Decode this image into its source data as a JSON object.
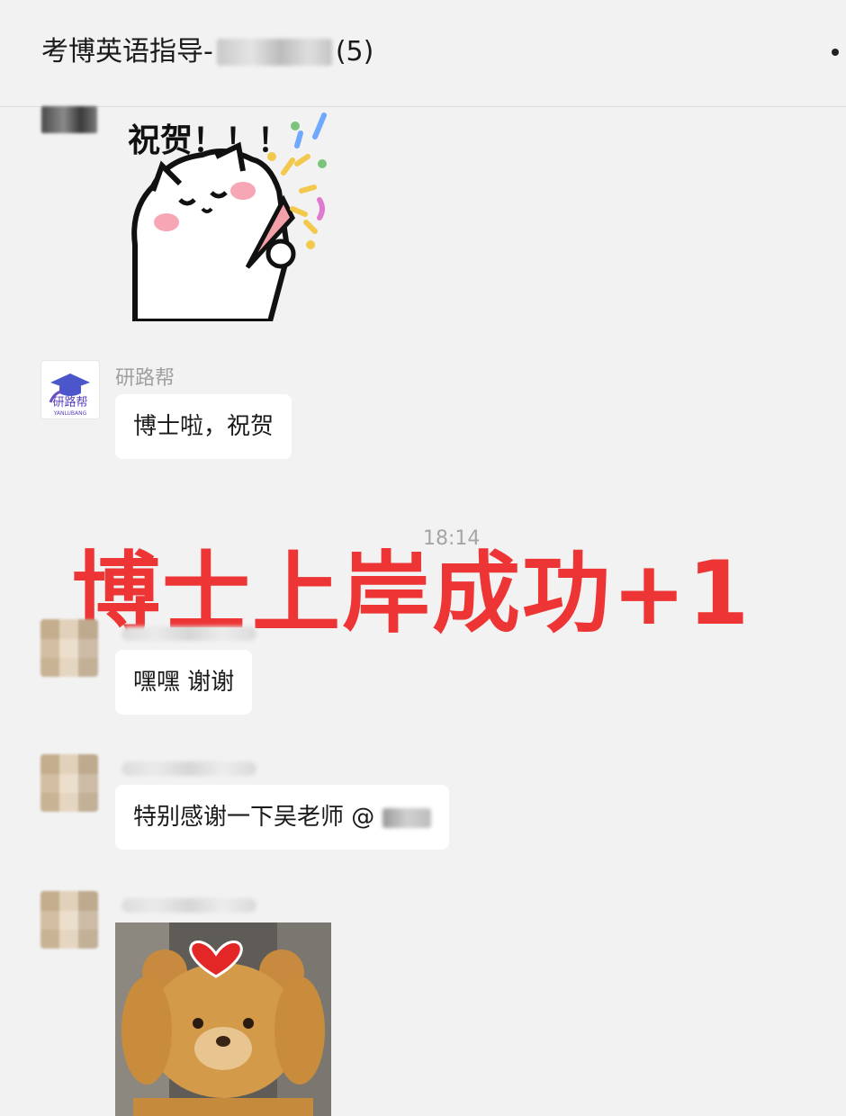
{
  "header": {
    "title_prefix": "考博英语指导-",
    "count": "(5)"
  },
  "messages": [
    {
      "type": "sticker",
      "sticker_text": "祝贺！！！"
    },
    {
      "type": "text",
      "sender": "研路帮",
      "logo_text": "研路帮",
      "logo_sub": "YANLUBANG",
      "text": "博士啦，祝贺"
    },
    {
      "type": "text",
      "text": "嘿嘿 谢谢"
    },
    {
      "type": "text",
      "text_prefix": "特别感谢一下吴老师 @"
    },
    {
      "type": "image"
    }
  ],
  "timestamp": "18:14",
  "overlay_text": "博士上岸成功+1",
  "colors": {
    "overlay": "#ee3535",
    "background": "#f2f2f2",
    "bubble": "#ffffff"
  }
}
